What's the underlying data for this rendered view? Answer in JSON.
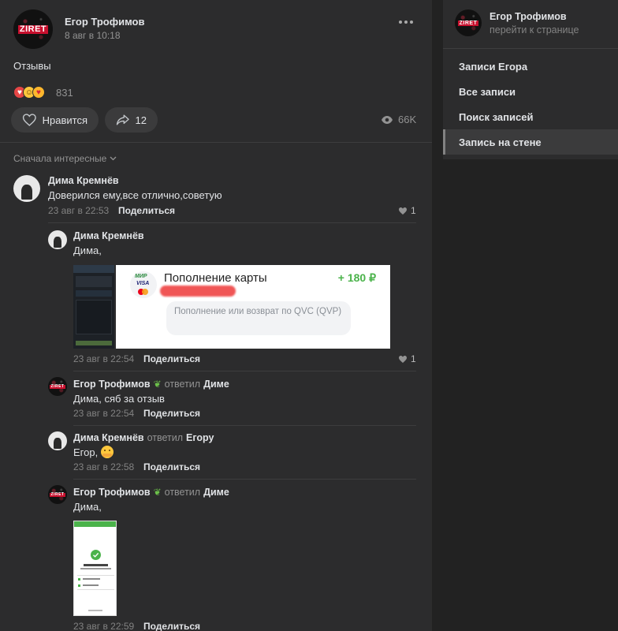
{
  "post": {
    "author": "Егор Трофимов",
    "avatar_text": "ZIRET",
    "date": "8 авг в 10:18",
    "text": "Отзывы",
    "reactions_count": "831",
    "like_label": "Нравится",
    "shares_count": "12",
    "views": "66K",
    "menu_icon": "more-icon"
  },
  "comments_header": {
    "sort_label": "Сначала интересные"
  },
  "comments": [
    {
      "author": "Дима Кремнёв",
      "text": "Доверился ему,все отлично,советую",
      "date": "23 авг в 22:53",
      "share": "Поделиться",
      "likes": "1"
    },
    {
      "author": "Дима Кремнёв",
      "text": "Дима,",
      "date": "23 авг в 22:54",
      "share": "Поделиться",
      "likes": "1"
    },
    {
      "author": "Егор Трофимов",
      "replied_word": "ответил",
      "replied_to": "Диме",
      "text": "Дима, сяб за отзыв",
      "date": "23 авг в 22:54",
      "share": "Поделиться"
    },
    {
      "author": "Дима Кремнёв",
      "replied_word": "ответил",
      "replied_to": "Егору",
      "text": "Егор,",
      "date": "23 авг в 22:58",
      "share": "Поделиться"
    },
    {
      "author": "Егор Трофимов",
      "replied_word": "ответил",
      "replied_to": "Диме",
      "text": "Дима,",
      "date": "23 авг в 22:59",
      "share": "Поделиться"
    }
  ],
  "receipt": {
    "title": "Пополнение карты",
    "amount": "+ 180 ₽",
    "brand_top": "МИР",
    "brand_mid": "VISA",
    "note": "Пополнение или возврат по QVC (QVP)"
  },
  "sidebar": {
    "owner_name": "Егор Трофимов",
    "owner_link": "перейти к странице",
    "items": [
      {
        "label": "Записи Егора"
      },
      {
        "label": "Все записи"
      },
      {
        "label": "Поиск записей"
      },
      {
        "label": "Запись на стене"
      }
    ]
  },
  "colors": {
    "accent_green": "#4bb34b",
    "panel": "#2c2c2d",
    "background": "#222222"
  }
}
